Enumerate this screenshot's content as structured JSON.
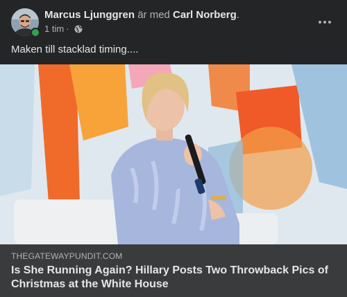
{
  "post": {
    "author": "Marcus Ljunggren",
    "with_text": "är med",
    "tagged": "Carl Norberg",
    "tagged_suffix": ".",
    "timestamp": "1 tim",
    "separator": "·",
    "audience_icon": "globe-icon",
    "more_icon": "more-options-icon",
    "text": "Maken till stacklad timing...."
  },
  "link": {
    "domain": "THEGATEWAYPUNDIT.COM",
    "title": "Is She Running Again? Hillary Posts Two Throwback Pics of Christmas at the White House"
  },
  "colors": {
    "card_bg": "#242526",
    "link_info_bg": "#3a3b3c",
    "primary_text": "#e4e6eb",
    "secondary_text": "#b0b3b8",
    "online_green": "#31a24c"
  }
}
